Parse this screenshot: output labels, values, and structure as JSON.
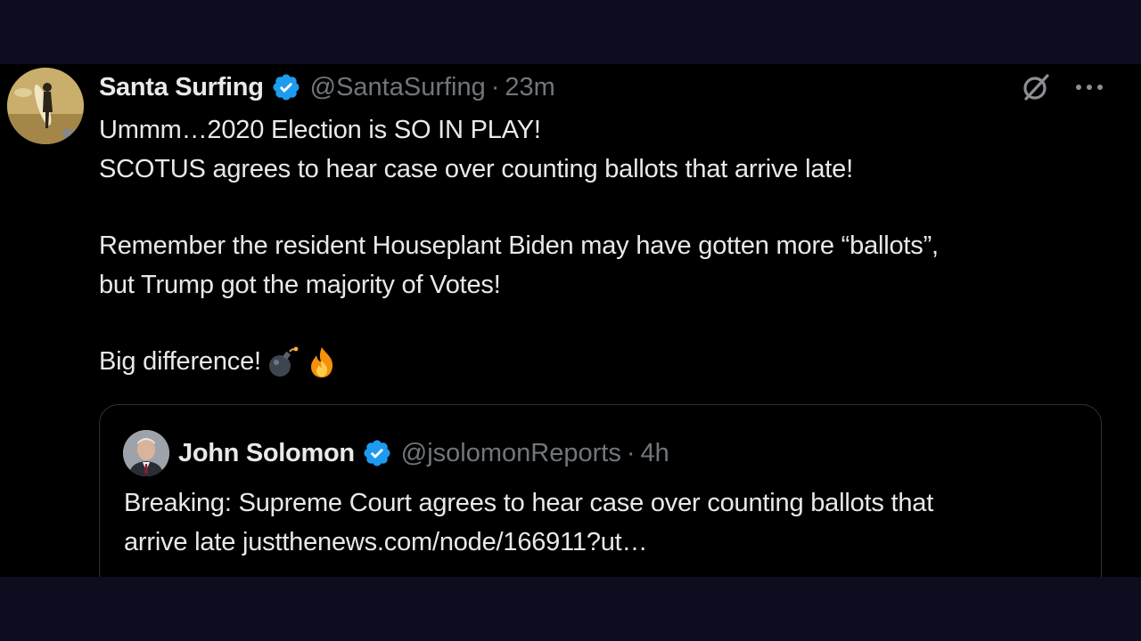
{
  "tweet": {
    "author_name": "Santa Surfing",
    "handle": "@SantaSurfing",
    "separator": "·",
    "time": "23m",
    "verified_color": "#1d9bf0",
    "avatar_icon": "surfer-avatar",
    "lines": [
      "Ummm…2020 Election is SO IN PLAY!",
      "SCOTUS agrees to hear case over counting ballots that arrive late!",
      "Remember the resident Houseplant Biden may have gotten more “ballots”,",
      "but Trump got the majority of Votes!",
      "Big difference!"
    ],
    "emojis": [
      "bomb-emoji",
      "fire-emoji"
    ]
  },
  "toolbar": {
    "grok_icon": "grok-icon",
    "more_icon": "more-options-icon"
  },
  "quoted_tweet": {
    "author_name": "John Solomon",
    "handle": "@jsolomonReports",
    "separator": "·",
    "time": "4h",
    "avatar_icon": "john-solomon-avatar",
    "lines": [
      "Breaking: Supreme Court agrees to hear case over counting ballots that",
      "arrive late justthenews.com/node/166911?ut…"
    ]
  },
  "colors": {
    "background": "#000000",
    "outer_background": "#0e0c1f",
    "text": "#e7e9ea",
    "secondary_text": "#71767b",
    "border": "#2f3336"
  }
}
